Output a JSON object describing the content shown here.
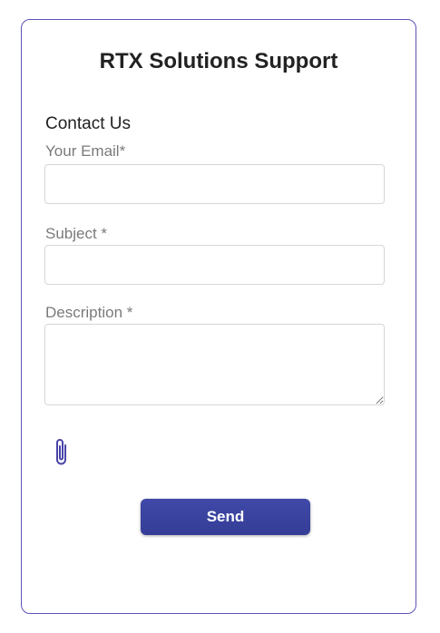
{
  "form": {
    "title": "RTX Solutions Support",
    "heading": "Contact Us",
    "email": {
      "label": "Your Email*",
      "value": "",
      "placeholder": ""
    },
    "subject": {
      "label": "Subject *",
      "value": "",
      "placeholder": ""
    },
    "description": {
      "label": "Description *",
      "value": "",
      "placeholder": ""
    },
    "attach_icon": "paperclip-icon",
    "send_label": "Send"
  },
  "colors": {
    "accent": "#3b43a0",
    "border": "#5a52b8",
    "icon": "#4a44a8"
  }
}
